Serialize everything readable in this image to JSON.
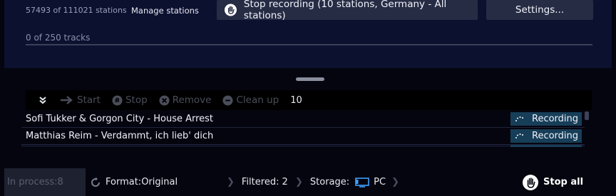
{
  "header": {
    "stations_count": "57493 of 111021 stations",
    "manage_label": "Manage stations",
    "stop_recording_label": "Stop recording (10 stations, Germany - All stations)",
    "settings_label": "Settings...",
    "tracks_count": "0 of 250 tracks",
    "tracks_progress_percent": 0
  },
  "toolbar": {
    "collapse_icon": "double-chevron-down-icon",
    "start_label": "Start",
    "stop_label": "Stop",
    "remove_label": "Remove",
    "cleanup_label": "Clean up",
    "count": "10"
  },
  "recordings": [
    {
      "title": "Sofi Tukker & Gorgon City - House Arrest",
      "status": "Recording"
    },
    {
      "title": "Matthias Reim - Verdammt, ich lieb' dich",
      "status": "Recording"
    }
  ],
  "statusbar": {
    "in_process_label": "In process:",
    "in_process_value": "8",
    "format_label": "Format:",
    "format_value": "Original",
    "filtered_label": "Filtered:",
    "filtered_value": "2",
    "storage_label": "Storage:",
    "storage_value": "PC",
    "stop_all_label": "Stop all"
  },
  "colors": {
    "background": "#05050f",
    "panel": "#0d1130",
    "button": "#262c44",
    "status_badge": "#173e58",
    "disabled_text": "#4a4e5a"
  }
}
